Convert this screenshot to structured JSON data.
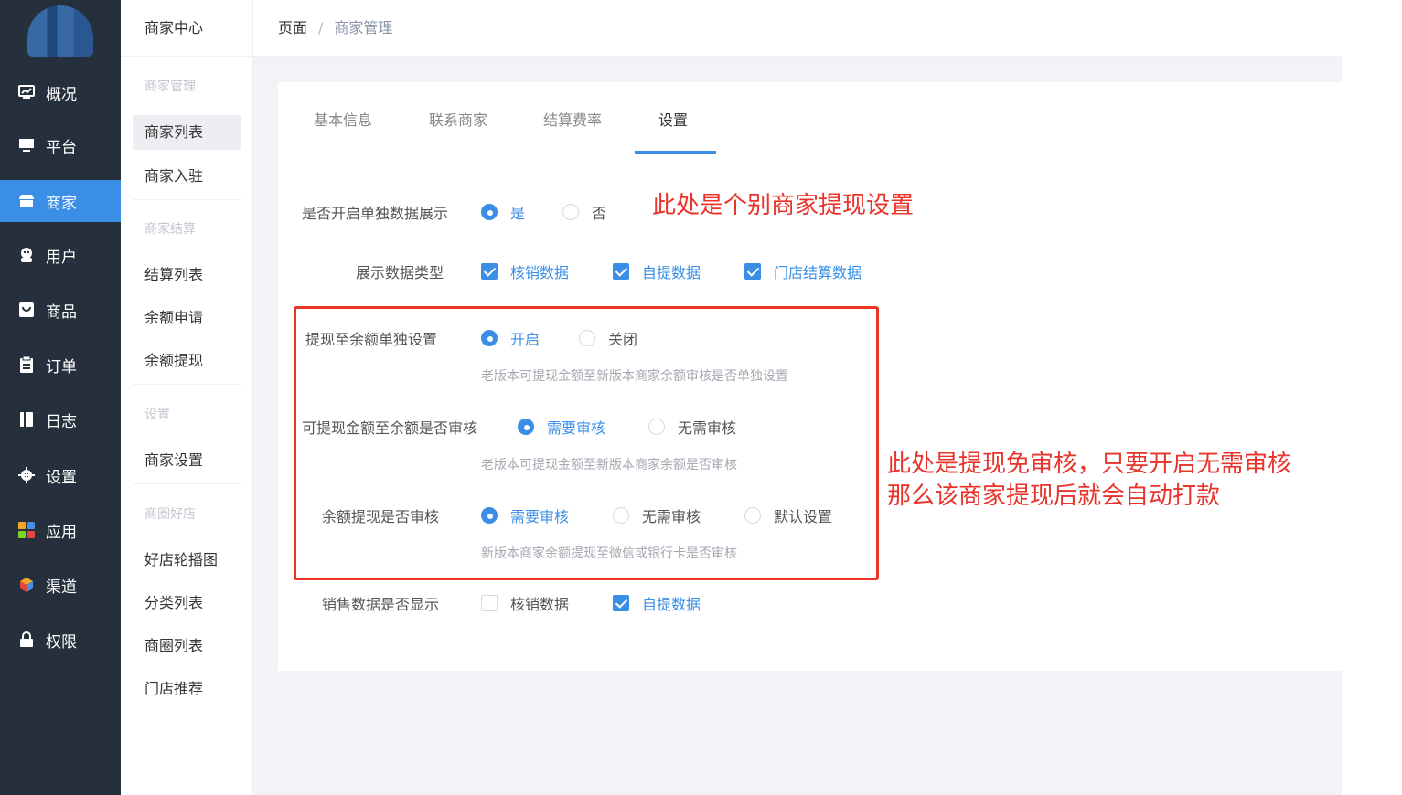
{
  "nav1": {
    "items": [
      {
        "label": "概况",
        "icon": "dashboard-icon"
      },
      {
        "label": "平台",
        "icon": "monitor-icon"
      },
      {
        "label": "商家",
        "icon": "store-icon"
      },
      {
        "label": "用户",
        "icon": "user-icon"
      },
      {
        "label": "商品",
        "icon": "goods-icon"
      },
      {
        "label": "订单",
        "icon": "clipboard-icon"
      },
      {
        "label": "日志",
        "icon": "book-icon"
      },
      {
        "label": "设置",
        "icon": "gear-icon"
      },
      {
        "label": "应用",
        "icon": "apps-icon"
      },
      {
        "label": "渠道",
        "icon": "cube-icon"
      },
      {
        "label": "权限",
        "icon": "lock-icon"
      }
    ],
    "active": "商家"
  },
  "nav2": {
    "title": "商家中心",
    "groups": {
      "merchant_manage": "商家管理",
      "merchant_settle": "商家结算",
      "settings": "设置",
      "circle_shop": "商圈好店"
    },
    "items": {
      "merchant_list": "商家列表",
      "merchant_join": "商家入驻",
      "settle_list": "结算列表",
      "balance_apply": "余额申请",
      "balance_withdraw": "余额提现",
      "merchant_settings": "商家设置",
      "shop_carousel": "好店轮播图",
      "category_list": "分类列表",
      "circle_list": "商圈列表",
      "store_recommend": "门店推荐"
    }
  },
  "breadcrumb": {
    "root": "页面",
    "sep": "/",
    "current": "商家管理"
  },
  "tabs": [
    "基本信息",
    "联系商家",
    "结算费率",
    "设置"
  ],
  "form": {
    "single_display": {
      "label": "是否开启单独数据展示",
      "yes": "是",
      "no": "否",
      "selected": "是"
    },
    "display_types": {
      "label": "展示数据类型",
      "options": [
        "核销数据",
        "自提数据",
        "门店结算数据"
      ],
      "checked": [
        true,
        true,
        true
      ]
    },
    "withdraw_separate": {
      "label": "提现至余额单独设置",
      "on": "开启",
      "off": "关闭",
      "selected": "开启",
      "hint": "老版本可提现金额至新版本商家余额审核是否单独设置"
    },
    "withdraw_review": {
      "label": "可提现金额至余额是否审核",
      "need": "需要审核",
      "no_need": "无需审核",
      "selected": "需要审核",
      "hint": "老版本可提现金额至新版本商家余额是否审核"
    },
    "balance_review": {
      "label": "余额提现是否审核",
      "need": "需要审核",
      "no_need": "无需审核",
      "default": "默认设置",
      "selected": "需要审核",
      "hint": "新版本商家余额提现至微信或银行卡是否审核"
    },
    "sales_display": {
      "label": "销售数据是否显示",
      "options": [
        "核销数据",
        "自提数据"
      ],
      "checked": [
        false,
        true
      ]
    }
  },
  "annotations": {
    "top": "此处是个别商家提现设置",
    "side_line1": "此处是提现免审核，只要开启无需审核",
    "side_line2": "那么该商家提现后就会自动打款"
  },
  "colors": {
    "accent": "#3a8ee6",
    "sidebar": "#26303d",
    "annotation": "#e8342b"
  }
}
